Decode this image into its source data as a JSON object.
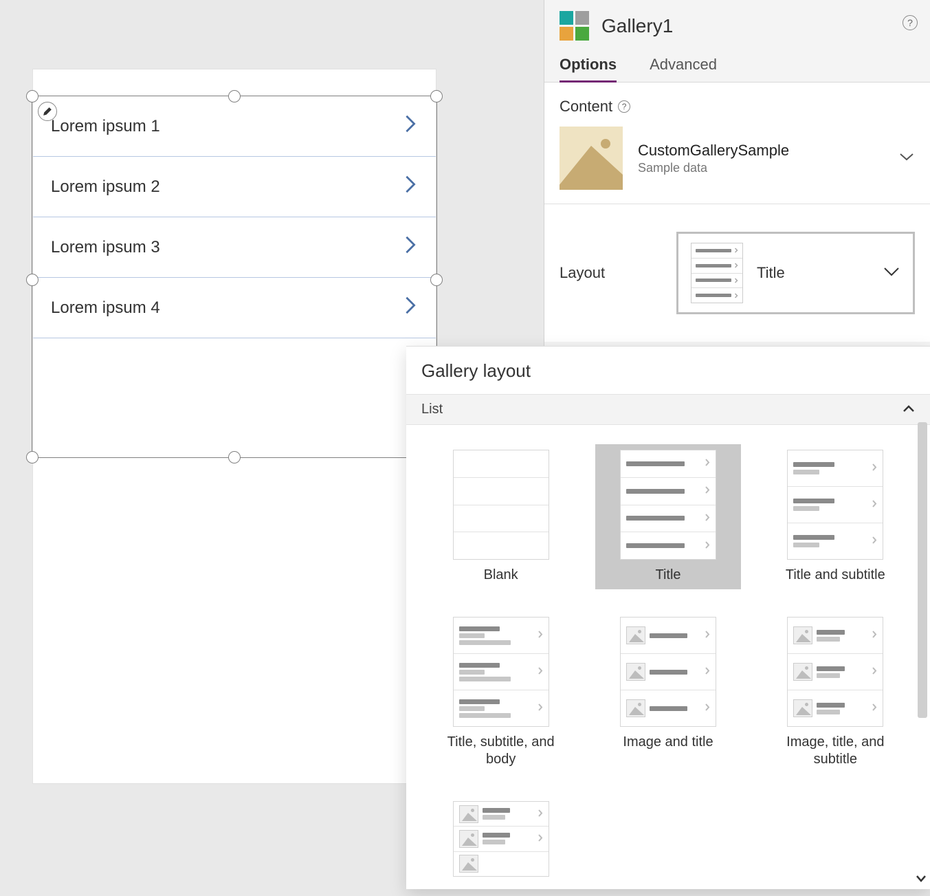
{
  "gallery": {
    "items": [
      {
        "title": "Lorem ipsum 1"
      },
      {
        "title": "Lorem ipsum 2"
      },
      {
        "title": "Lorem ipsum 3"
      },
      {
        "title": "Lorem ipsum 4"
      }
    ]
  },
  "panel": {
    "title": "Gallery1",
    "tabs": {
      "options": "Options",
      "advanced": "Advanced",
      "active": "options"
    },
    "content": {
      "heading": "Content",
      "datasource_name": "CustomGallerySample",
      "datasource_sub": "Sample data"
    },
    "layout": {
      "label": "Layout",
      "selected": "Title"
    }
  },
  "flyout": {
    "title": "Gallery layout",
    "group": "List",
    "tiles": [
      {
        "key": "blank",
        "label": "Blank",
        "selected": false
      },
      {
        "key": "title",
        "label": "Title",
        "selected": true
      },
      {
        "key": "title_subtitle",
        "label": "Title and subtitle",
        "selected": false
      },
      {
        "key": "title_subtitle_body",
        "label": "Title, subtitle, and body",
        "selected": false
      },
      {
        "key": "image_title",
        "label": "Image and title",
        "selected": false
      },
      {
        "key": "image_title_subtitle",
        "label": "Image, title, and subtitle",
        "selected": false
      }
    ]
  }
}
